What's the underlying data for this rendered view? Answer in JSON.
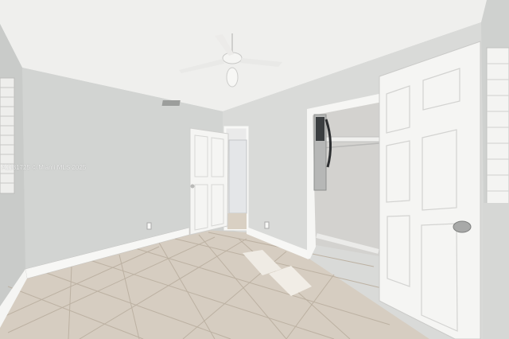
{
  "photo": {
    "watermark": "A1181725 © Miami MLS 2025",
    "colors": {
      "ceiling": "#f0f0ee",
      "wall": "#d4d6d4",
      "wall_light": "#dfe0de",
      "floor_tile": "#d8d0c4",
      "grout": "#b8ad9e",
      "baseboard": "#f7f7f5",
      "door": "#f4f4f2",
      "door_panel_edge": "#d8d8d6"
    }
  }
}
